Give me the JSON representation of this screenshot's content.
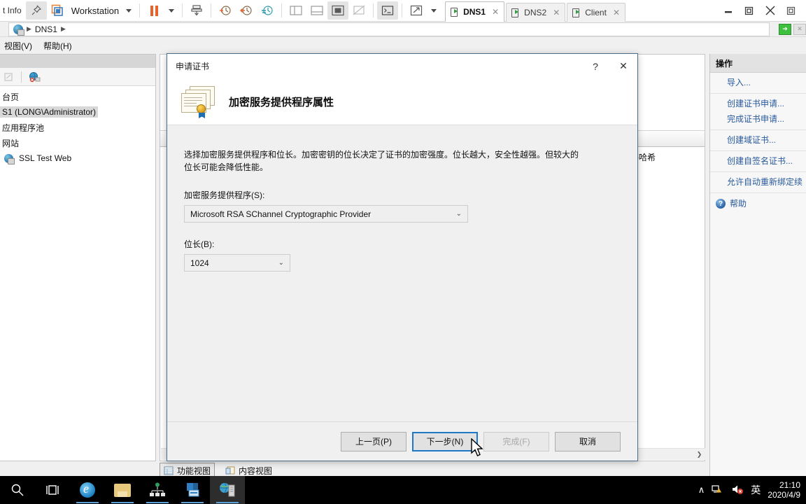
{
  "vmware": {
    "left_label": "t Info",
    "workstation_label": "Workstation",
    "toolbar_icons": [
      "pin-icon",
      "vm-library-icon",
      "pause-icon",
      "pause-dropdown-icon",
      "snapshot-icon",
      "snapshot-manager-icon",
      "revert-snapshot-icon",
      "take-snapshot-icon",
      "split-view-icon",
      "bottom-view-icon",
      "fullscreen-icon",
      "unity-icon",
      "console-icon",
      "expand-icon"
    ],
    "tabs": [
      {
        "label": "DNS1",
        "active": true
      },
      {
        "label": "DNS2",
        "active": false
      },
      {
        "label": "Client",
        "active": false
      }
    ],
    "window_controls": [
      "minimize-icon",
      "restore-icon",
      "close-icon"
    ]
  },
  "iis": {
    "address": {
      "breadcrumb": [
        "DNS1"
      ],
      "right_buttons": [
        "go-button",
        "stop-button"
      ]
    },
    "menu": [
      {
        "label": "视图(V)"
      },
      {
        "label": "帮助(H)"
      }
    ],
    "tree": {
      "items": [
        {
          "label": "台页",
          "icon": "start-page-icon",
          "selected": false
        },
        {
          "label": "S1 (LONG\\Administrator)",
          "icon": "server-icon",
          "selected": true
        },
        {
          "label": "应用程序池",
          "icon": "app-pool-icon",
          "selected": false
        },
        {
          "label": "网站",
          "icon": "sites-icon",
          "selected": false
        },
        {
          "label": "SSL Test Web",
          "icon": "website-icon",
          "selected": false
        }
      ]
    },
    "content": {
      "grid_columns": [
        "证书哈希"
      ]
    },
    "view_tabs": [
      {
        "label": "功能视图",
        "icon": "features-view-icon",
        "selected": true
      },
      {
        "label": "内容视图",
        "icon": "content-view-icon",
        "selected": false
      }
    ],
    "actions": {
      "title": "操作",
      "groups": [
        [
          "导入..."
        ],
        [
          "创建证书申请...",
          "完成证书申请..."
        ],
        [
          "创建域证书..."
        ],
        [
          "创建自签名证书..."
        ],
        [
          "允许自动重新绑定续"
        ]
      ],
      "help_label": "帮助"
    }
  },
  "dialog": {
    "title": "申请证书",
    "help_button": "?",
    "close_button": "✕",
    "heading": "加密服务提供程序属性",
    "icon": "certificate-icon",
    "description": "选择加密服务提供程序和位长。加密密钥的位长决定了证书的加密强度。位长越大，安全性越强。但较大的位长可能会降低性能。",
    "provider": {
      "label": "加密服务提供程序(S):",
      "value": "Microsoft RSA SChannel Cryptographic Provider"
    },
    "bitlength": {
      "label": "位长(B):",
      "value": "1024"
    },
    "buttons": [
      {
        "label": "上一页(P)",
        "state": "normal"
      },
      {
        "label": "下一步(N)",
        "state": "default"
      },
      {
        "label": "完成(F)",
        "state": "disabled"
      },
      {
        "label": "取消",
        "state": "normal"
      }
    ]
  },
  "taskbar": {
    "items": [
      {
        "icon": "search-icon",
        "running": false,
        "active": false
      },
      {
        "icon": "task-view-icon",
        "running": false,
        "active": false
      },
      {
        "icon": "internet-explorer-icon",
        "running": true,
        "active": false
      },
      {
        "icon": "file-explorer-icon",
        "running": true,
        "active": false
      },
      {
        "icon": "dns-manager-icon",
        "running": true,
        "active": false
      },
      {
        "icon": "server-manager-icon",
        "running": true,
        "active": false
      },
      {
        "icon": "iis-manager-icon",
        "running": true,
        "active": true
      }
    ],
    "tray": {
      "chevron": "∧",
      "network_icon": "network-warning-icon",
      "volume_icon": "volume-muted-icon",
      "ime_label": "英",
      "time": "21:10",
      "date": "2020/4/9"
    }
  },
  "colors": {
    "accent": "#1e78c8",
    "link": "#2a5a9c",
    "orange": "#e8622a",
    "taskbar_bg": "#000000"
  }
}
